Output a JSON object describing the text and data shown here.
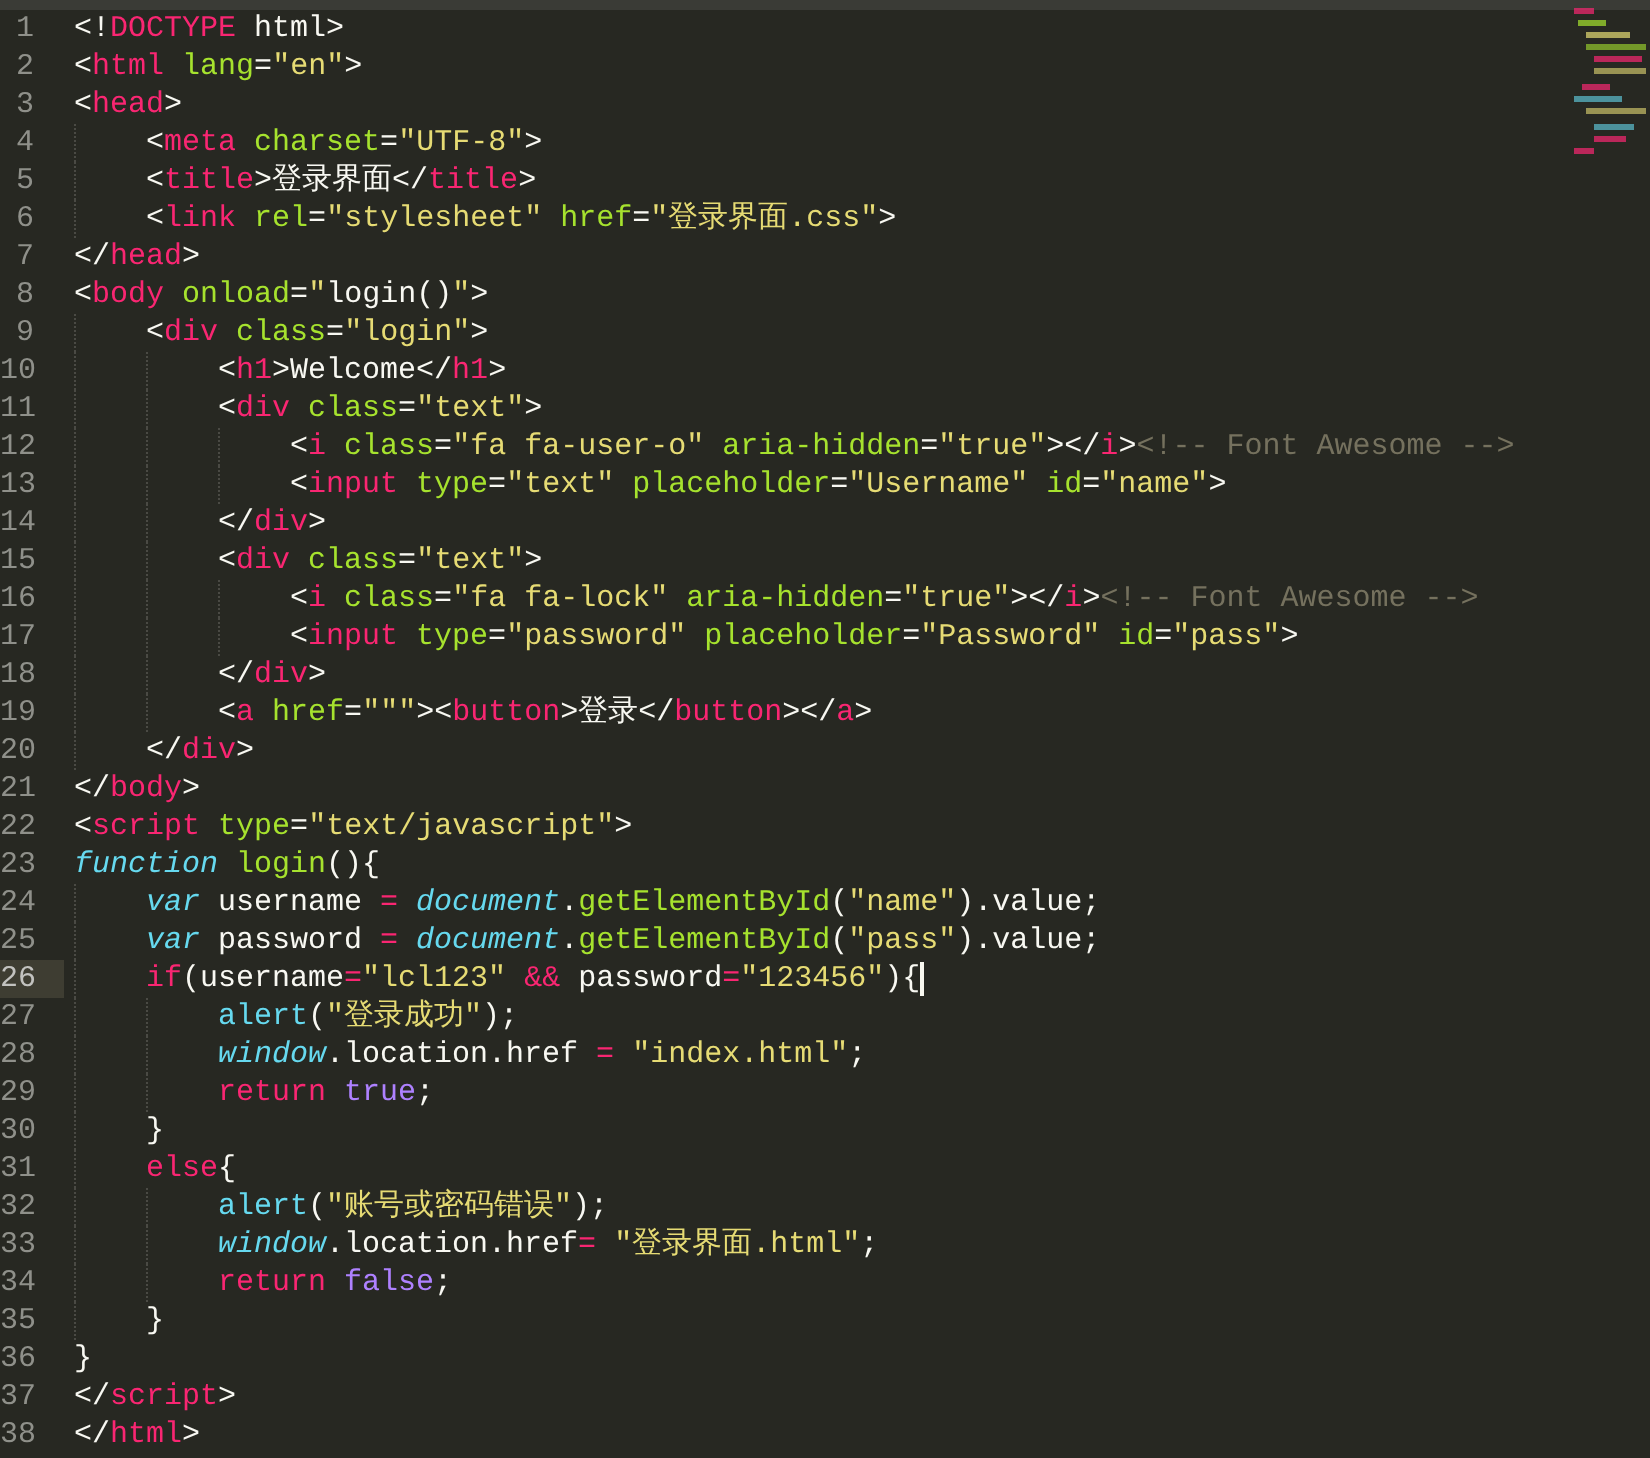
{
  "editor": {
    "lines": [
      {
        "number": "1",
        "current": false,
        "tokens": [
          {
            "kind": "punct",
            "text": "<!"
          },
          {
            "kind": "tag",
            "text": "DOCTYPE"
          },
          {
            "kind": "punct",
            "text": " html>"
          }
        ]
      },
      {
        "number": "2",
        "current": false,
        "tokens": [
          {
            "kind": "punct",
            "text": "<"
          },
          {
            "kind": "tag",
            "text": "html"
          },
          {
            "kind": "attr",
            "text": " lang"
          },
          {
            "kind": "punct",
            "text": "="
          },
          {
            "kind": "string",
            "text": "\"en\""
          },
          {
            "kind": "punct",
            "text": ">"
          }
        ]
      },
      {
        "number": "3",
        "current": false,
        "tokens": [
          {
            "kind": "punct",
            "text": "<"
          },
          {
            "kind": "tag",
            "text": "head"
          },
          {
            "kind": "punct",
            "text": ">"
          }
        ]
      },
      {
        "number": "4",
        "current": false,
        "tokens": [
          {
            "kind": "punct",
            "text": "    <"
          },
          {
            "kind": "tag",
            "text": "meta"
          },
          {
            "kind": "attr",
            "text": " charset"
          },
          {
            "kind": "punct",
            "text": "="
          },
          {
            "kind": "string",
            "text": "\"UTF-8\""
          },
          {
            "kind": "punct",
            "text": ">"
          }
        ]
      },
      {
        "number": "5",
        "current": false,
        "tokens": [
          {
            "kind": "punct",
            "text": "    <"
          },
          {
            "kind": "tag",
            "text": "title"
          },
          {
            "kind": "punct",
            "text": ">登录界面</"
          },
          {
            "kind": "tag",
            "text": "title"
          },
          {
            "kind": "punct",
            "text": ">"
          }
        ]
      },
      {
        "number": "6",
        "current": false,
        "tokens": [
          {
            "kind": "punct",
            "text": "    <"
          },
          {
            "kind": "tag",
            "text": "link"
          },
          {
            "kind": "attr",
            "text": " rel"
          },
          {
            "kind": "punct",
            "text": "="
          },
          {
            "kind": "string",
            "text": "\"stylesheet\""
          },
          {
            "kind": "attr",
            "text": " href"
          },
          {
            "kind": "punct",
            "text": "="
          },
          {
            "kind": "string",
            "text": "\"登录界面.css\""
          },
          {
            "kind": "punct",
            "text": ">"
          }
        ]
      },
      {
        "number": "7",
        "current": false,
        "tokens": [
          {
            "kind": "punct",
            "text": "</"
          },
          {
            "kind": "tag",
            "text": "head"
          },
          {
            "kind": "punct",
            "text": ">"
          }
        ]
      },
      {
        "number": "8",
        "current": false,
        "tokens": [
          {
            "kind": "punct",
            "text": "<"
          },
          {
            "kind": "tag",
            "text": "body"
          },
          {
            "kind": "attr",
            "text": " onload"
          },
          {
            "kind": "punct",
            "text": "="
          },
          {
            "kind": "string",
            "text": "\""
          },
          {
            "kind": "punct",
            "text": "login()"
          },
          {
            "kind": "string",
            "text": "\""
          },
          {
            "kind": "punct",
            "text": ">"
          }
        ]
      },
      {
        "number": "9",
        "current": false,
        "tokens": [
          {
            "kind": "punct",
            "text": "    <"
          },
          {
            "kind": "tag",
            "text": "div"
          },
          {
            "kind": "attr",
            "text": " class"
          },
          {
            "kind": "punct",
            "text": "="
          },
          {
            "kind": "string",
            "text": "\"login\""
          },
          {
            "kind": "punct",
            "text": ">"
          }
        ]
      },
      {
        "number": "10",
        "current": false,
        "tokens": [
          {
            "kind": "punct",
            "text": "        <"
          },
          {
            "kind": "tag",
            "text": "h1"
          },
          {
            "kind": "punct",
            "text": ">Welcome</"
          },
          {
            "kind": "tag",
            "text": "h1"
          },
          {
            "kind": "punct",
            "text": ">"
          }
        ]
      },
      {
        "number": "11",
        "current": false,
        "tokens": [
          {
            "kind": "punct",
            "text": "        <"
          },
          {
            "kind": "tag",
            "text": "div"
          },
          {
            "kind": "attr",
            "text": " class"
          },
          {
            "kind": "punct",
            "text": "="
          },
          {
            "kind": "string",
            "text": "\"text\""
          },
          {
            "kind": "punct",
            "text": ">"
          }
        ]
      },
      {
        "number": "12",
        "current": false,
        "tokens": [
          {
            "kind": "punct",
            "text": "            <"
          },
          {
            "kind": "tag",
            "text": "i"
          },
          {
            "kind": "attr",
            "text": " class"
          },
          {
            "kind": "punct",
            "text": "="
          },
          {
            "kind": "string",
            "text": "\"fa fa-user-o\""
          },
          {
            "kind": "attr",
            "text": " aria-hidden"
          },
          {
            "kind": "punct",
            "text": "="
          },
          {
            "kind": "string",
            "text": "\"true\""
          },
          {
            "kind": "punct",
            "text": "></"
          },
          {
            "kind": "tag",
            "text": "i"
          },
          {
            "kind": "punct",
            "text": ">"
          },
          {
            "kind": "comment",
            "text": "<!-- Font Awesome -->"
          }
        ]
      },
      {
        "number": "13",
        "current": false,
        "tokens": [
          {
            "kind": "punct",
            "text": "            <"
          },
          {
            "kind": "tag",
            "text": "input"
          },
          {
            "kind": "attr",
            "text": " type"
          },
          {
            "kind": "punct",
            "text": "="
          },
          {
            "kind": "string",
            "text": "\"text\""
          },
          {
            "kind": "attr",
            "text": " placeholder"
          },
          {
            "kind": "punct",
            "text": "="
          },
          {
            "kind": "string",
            "text": "\"Username\""
          },
          {
            "kind": "attr",
            "text": " id"
          },
          {
            "kind": "punct",
            "text": "="
          },
          {
            "kind": "string",
            "text": "\"name\""
          },
          {
            "kind": "punct",
            "text": ">"
          }
        ]
      },
      {
        "number": "14",
        "current": false,
        "tokens": [
          {
            "kind": "punct",
            "text": "        </"
          },
          {
            "kind": "tag",
            "text": "div"
          },
          {
            "kind": "punct",
            "text": ">"
          }
        ]
      },
      {
        "number": "15",
        "current": false,
        "tokens": [
          {
            "kind": "punct",
            "text": "        <"
          },
          {
            "kind": "tag",
            "text": "div"
          },
          {
            "kind": "attr",
            "text": " class"
          },
          {
            "kind": "punct",
            "text": "="
          },
          {
            "kind": "string",
            "text": "\"text\""
          },
          {
            "kind": "punct",
            "text": ">"
          }
        ]
      },
      {
        "number": "16",
        "current": false,
        "tokens": [
          {
            "kind": "punct",
            "text": "            <"
          },
          {
            "kind": "tag",
            "text": "i"
          },
          {
            "kind": "attr",
            "text": " class"
          },
          {
            "kind": "punct",
            "text": "="
          },
          {
            "kind": "string",
            "text": "\"fa fa-lock\""
          },
          {
            "kind": "attr",
            "text": " aria-hidden"
          },
          {
            "kind": "punct",
            "text": "="
          },
          {
            "kind": "string",
            "text": "\"true\""
          },
          {
            "kind": "punct",
            "text": "></"
          },
          {
            "kind": "tag",
            "text": "i"
          },
          {
            "kind": "punct",
            "text": ">"
          },
          {
            "kind": "comment",
            "text": "<!-- Font Awesome -->"
          }
        ]
      },
      {
        "number": "17",
        "current": false,
        "tokens": [
          {
            "kind": "punct",
            "text": "            <"
          },
          {
            "kind": "tag",
            "text": "input"
          },
          {
            "kind": "attr",
            "text": " type"
          },
          {
            "kind": "punct",
            "text": "="
          },
          {
            "kind": "string",
            "text": "\"password\""
          },
          {
            "kind": "attr",
            "text": " placeholder"
          },
          {
            "kind": "punct",
            "text": "="
          },
          {
            "kind": "string",
            "text": "\"Password\""
          },
          {
            "kind": "attr",
            "text": " id"
          },
          {
            "kind": "punct",
            "text": "="
          },
          {
            "kind": "string",
            "text": "\"pass\""
          },
          {
            "kind": "punct",
            "text": ">"
          }
        ]
      },
      {
        "number": "18",
        "current": false,
        "tokens": [
          {
            "kind": "punct",
            "text": "        </"
          },
          {
            "kind": "tag",
            "text": "div"
          },
          {
            "kind": "punct",
            "text": ">"
          }
        ]
      },
      {
        "number": "19",
        "current": false,
        "tokens": [
          {
            "kind": "punct",
            "text": "        <"
          },
          {
            "kind": "tag",
            "text": "a"
          },
          {
            "kind": "attr",
            "text": " href"
          },
          {
            "kind": "punct",
            "text": "="
          },
          {
            "kind": "string",
            "text": "\"\"\""
          },
          {
            "kind": "punct",
            "text": "><"
          },
          {
            "kind": "tag",
            "text": "button"
          },
          {
            "kind": "punct",
            "text": ">登录</"
          },
          {
            "kind": "tag",
            "text": "button"
          },
          {
            "kind": "punct",
            "text": "></"
          },
          {
            "kind": "tag",
            "text": "a"
          },
          {
            "kind": "punct",
            "text": ">"
          }
        ]
      },
      {
        "number": "20",
        "current": false,
        "tokens": [
          {
            "kind": "punct",
            "text": "    </"
          },
          {
            "kind": "tag",
            "text": "div"
          },
          {
            "kind": "punct",
            "text": ">"
          }
        ]
      },
      {
        "number": "21",
        "current": false,
        "tokens": [
          {
            "kind": "punct",
            "text": "</"
          },
          {
            "kind": "tag",
            "text": "body"
          },
          {
            "kind": "punct",
            "text": ">"
          }
        ]
      },
      {
        "number": "22",
        "current": false,
        "tokens": [
          {
            "kind": "punct",
            "text": "<"
          },
          {
            "kind": "tag",
            "text": "script"
          },
          {
            "kind": "attr",
            "text": " type"
          },
          {
            "kind": "punct",
            "text": "="
          },
          {
            "kind": "string",
            "text": "\"text/javascript\""
          },
          {
            "kind": "punct",
            "text": ">"
          }
        ]
      },
      {
        "number": "23",
        "current": false,
        "tokens": [
          {
            "kind": "storage",
            "text": "function"
          },
          {
            "kind": "entity",
            "text": " login"
          },
          {
            "kind": "punct",
            "text": "(){"
          }
        ]
      },
      {
        "number": "24",
        "current": false,
        "tokens": [
          {
            "kind": "storage",
            "text": "    var"
          },
          {
            "kind": "punct",
            "text": " username "
          },
          {
            "kind": "keyword",
            "text": "="
          },
          {
            "kind": "storage",
            "text": " document"
          },
          {
            "kind": "punct",
            "text": "."
          },
          {
            "kind": "entity",
            "text": "getElementById"
          },
          {
            "kind": "punct",
            "text": "("
          },
          {
            "kind": "string",
            "text": "\"name\""
          },
          {
            "kind": "punct",
            "text": ").value;"
          }
        ]
      },
      {
        "number": "25",
        "current": false,
        "tokens": [
          {
            "kind": "storage",
            "text": "    var"
          },
          {
            "kind": "punct",
            "text": " password "
          },
          {
            "kind": "keyword",
            "text": "="
          },
          {
            "kind": "storage",
            "text": " document"
          },
          {
            "kind": "punct",
            "text": "."
          },
          {
            "kind": "entity",
            "text": "getElementById"
          },
          {
            "kind": "punct",
            "text": "("
          },
          {
            "kind": "string",
            "text": "\"pass\""
          },
          {
            "kind": "punct",
            "text": ").value;"
          }
        ]
      },
      {
        "number": "26",
        "current": true,
        "tokens": [
          {
            "kind": "keyword",
            "text": "    if"
          },
          {
            "kind": "punct",
            "text": "(username"
          },
          {
            "kind": "keyword",
            "text": "="
          },
          {
            "kind": "string",
            "text": "\"lcl123\""
          },
          {
            "kind": "keyword",
            "text": " &&"
          },
          {
            "kind": "punct",
            "text": " password"
          },
          {
            "kind": "keyword",
            "text": "="
          },
          {
            "kind": "string",
            "text": "\"123456\""
          },
          {
            "kind": "punct",
            "text": "){"
          }
        ]
      },
      {
        "number": "27",
        "current": false,
        "tokens": [
          {
            "kind": "support",
            "text": "        alert"
          },
          {
            "kind": "punct",
            "text": "("
          },
          {
            "kind": "string",
            "text": "\"登录成功\""
          },
          {
            "kind": "punct",
            "text": ");"
          }
        ]
      },
      {
        "number": "28",
        "current": false,
        "tokens": [
          {
            "kind": "storage",
            "text": "        window"
          },
          {
            "kind": "punct",
            "text": ".location.href "
          },
          {
            "kind": "keyword",
            "text": "="
          },
          {
            "kind": "string",
            "text": " \"index.html\""
          },
          {
            "kind": "punct",
            "text": ";"
          }
        ]
      },
      {
        "number": "29",
        "current": false,
        "tokens": [
          {
            "kind": "keyword",
            "text": "        return"
          },
          {
            "kind": "constant",
            "text": " true"
          },
          {
            "kind": "punct",
            "text": ";"
          }
        ]
      },
      {
        "number": "30",
        "current": false,
        "tokens": [
          {
            "kind": "punct",
            "text": "    }"
          }
        ]
      },
      {
        "number": "31",
        "current": false,
        "tokens": [
          {
            "kind": "keyword",
            "text": "    else"
          },
          {
            "kind": "punct",
            "text": "{"
          }
        ]
      },
      {
        "number": "32",
        "current": false,
        "tokens": [
          {
            "kind": "support",
            "text": "        alert"
          },
          {
            "kind": "punct",
            "text": "("
          },
          {
            "kind": "string",
            "text": "\"账号或密码错误\""
          },
          {
            "kind": "punct",
            "text": ");"
          }
        ]
      },
      {
        "number": "33",
        "current": false,
        "tokens": [
          {
            "kind": "storage",
            "text": "        window"
          },
          {
            "kind": "punct",
            "text": ".location.href"
          },
          {
            "kind": "keyword",
            "text": "="
          },
          {
            "kind": "string",
            "text": " \"登录界面.html\""
          },
          {
            "kind": "punct",
            "text": ";"
          }
        ]
      },
      {
        "number": "34",
        "current": false,
        "tokens": [
          {
            "kind": "keyword",
            "text": "        return"
          },
          {
            "kind": "constant",
            "text": " false"
          },
          {
            "kind": "punct",
            "text": ";"
          }
        ]
      },
      {
        "number": "35",
        "current": false,
        "tokens": [
          {
            "kind": "punct",
            "text": "    }"
          }
        ]
      },
      {
        "number": "36",
        "current": false,
        "tokens": [
          {
            "kind": "punct",
            "text": "}"
          }
        ]
      },
      {
        "number": "37",
        "current": false,
        "tokens": [
          {
            "kind": "punct",
            "text": "</"
          },
          {
            "kind": "tag",
            "text": "script"
          },
          {
            "kind": "punct",
            "text": ">"
          }
        ]
      },
      {
        "number": "38",
        "current": false,
        "tokens": [
          {
            "kind": "punct",
            "text": "</"
          },
          {
            "kind": "tag",
            "text": "html"
          },
          {
            "kind": "punct",
            "text": ">"
          }
        ]
      }
    ]
  }
}
